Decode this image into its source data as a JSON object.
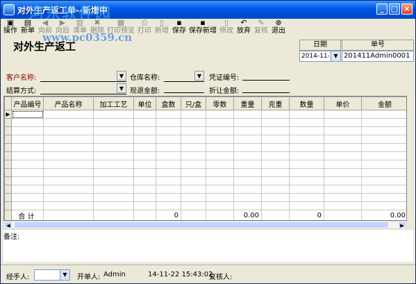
{
  "window": {
    "title": "对外生产返工单--新增中",
    "buttons": [
      "_",
      "□",
      "×"
    ]
  },
  "watermark": {
    "line1": "河东软件园",
    "line2": "www.pc0359.cn"
  },
  "toolbar": [
    {
      "label": "操作",
      "icon": "▣",
      "enabled": true
    },
    {
      "label": "新单",
      "icon": "▤",
      "enabled": true
    },
    {
      "label": "向前",
      "icon": "◀",
      "enabled": false
    },
    {
      "label": "向后",
      "icon": "▶",
      "enabled": false
    },
    {
      "label": "清单",
      "icon": "▥",
      "enabled": false
    },
    {
      "label": "删除",
      "icon": "✖",
      "enabled": false
    },
    {
      "label": "打印预览",
      "icon": "▦",
      "enabled": false
    },
    {
      "label": "打印",
      "icon": "⎙",
      "enabled": false
    },
    {
      "label": "新增",
      "icon": "▯",
      "enabled": false
    },
    {
      "label": "保存",
      "icon": "▪",
      "enabled": true
    },
    {
      "label": "保存新增",
      "icon": "▪",
      "enabled": true
    },
    {
      "label": "修改",
      "icon": "▯",
      "enabled": false
    },
    {
      "label": "放弃",
      "icon": "↶",
      "enabled": true
    },
    {
      "label": "复核",
      "icon": "✎",
      "enabled": false
    },
    {
      "label": "退出",
      "icon": "⊗",
      "enabled": true
    }
  ],
  "form": {
    "title": "对外生产返工",
    "date_label": "日期",
    "date_value": "2014-11-22",
    "number_label": "单号",
    "number_value": "201411Admin0001",
    "customer_label": "客户名称:",
    "warehouse_label": "仓库名称:",
    "voucher_label": "凭证编号:",
    "settle_label": "结算方式:",
    "cash_label": "现退金额:",
    "discount_label": "折让金额:"
  },
  "grid": {
    "columns": [
      "产品编号",
      "产品名称",
      "加工工艺",
      "单位",
      "盒数",
      "只/盒",
      "零数",
      "重量",
      "克重",
      "数量",
      "单价",
      "金额"
    ],
    "empty_rows": 12,
    "total_label": "合  计",
    "totals": [
      "",
      "",
      "",
      "",
      "0",
      "",
      "",
      "0.00",
      "",
      "0",
      "",
      "0.00"
    ]
  },
  "notes_label": "备注:",
  "footer": {
    "handler_label": "经手人:",
    "creator_label": "开单人:",
    "creator_value": "Admin",
    "timestamp": "14-11-22 15:43:02",
    "reviewer_label": "复核人:"
  }
}
